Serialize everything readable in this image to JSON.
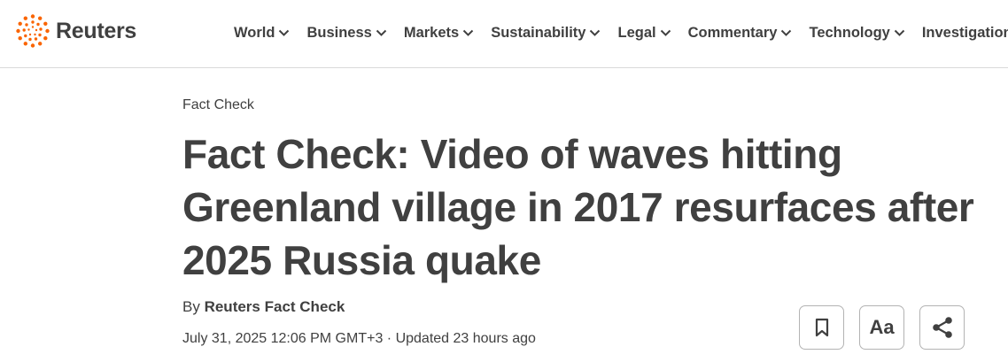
{
  "brand": {
    "name": "Reuters",
    "logo_color": "#fa6400"
  },
  "nav": [
    {
      "label": "World",
      "has_dropdown": true
    },
    {
      "label": "Business",
      "has_dropdown": true
    },
    {
      "label": "Markets",
      "has_dropdown": true
    },
    {
      "label": "Sustainability",
      "has_dropdown": true
    },
    {
      "label": "Legal",
      "has_dropdown": true
    },
    {
      "label": "Commentary",
      "has_dropdown": true
    },
    {
      "label": "Technology",
      "has_dropdown": true
    },
    {
      "label": "Investigations",
      "has_dropdown": false
    }
  ],
  "article": {
    "kicker": "Fact Check",
    "headline": "Fact Check: Video of waves hitting Greenland village in 2017 resurfaces after 2025 Russia quake",
    "byline_prefix": "By",
    "author": "Reuters Fact Check",
    "dateline": "July 31, 2025 12:06 PM GMT+3 · Updated 23 hours ago"
  },
  "tools": {
    "bookmark_icon": "bookmark-icon",
    "text_size_label": "Aa",
    "share_icon": "share-icon"
  },
  "colors": {
    "text": "#404040",
    "border": "#d9d9d9",
    "accent": "#fa6400"
  }
}
